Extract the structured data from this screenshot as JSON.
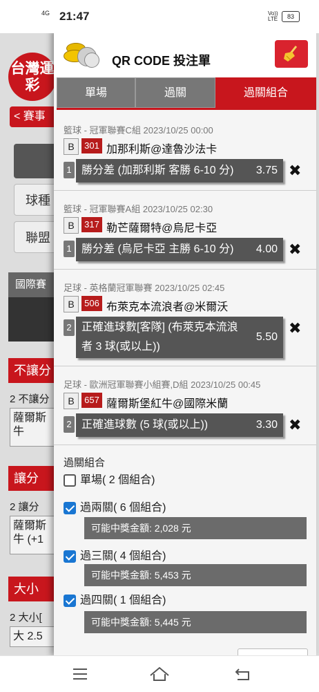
{
  "status_bar": {
    "signal": "4G",
    "time": "21:47",
    "volte": "Vo)) LTE",
    "battery": "83"
  },
  "background": {
    "logo_text": "台灣運彩",
    "tab_back": "< 賽事",
    "filter_sport": "球種",
    "filter_league": "聯盟",
    "intl_title": "國際賽",
    "section_no_handicap": "不讓分",
    "no_handicap_sub": "2 不讓分",
    "no_handicap_card": "薩爾斯 牛",
    "section_handicap": "讓分",
    "handicap_sub": "2 讓分",
    "handicap_card": "薩爾斯 牛 (+1",
    "section_total": "大小",
    "total_sub": "2 大小[",
    "total_card": "大 2.5"
  },
  "drawer": {
    "title": "QR CODE 投注單",
    "tabs": [
      "單場",
      "過關",
      "過關組合"
    ],
    "active_tab": 2,
    "colors": {
      "accent": "#c8161d",
      "check": "#1976d2"
    },
    "bets": [
      {
        "info": "籃球 - 冠軍聯賽C組 2023/10/25 00:00",
        "b": "B",
        "num": "301",
        "teams": "加那利斯@達魯沙法卡",
        "idx": "1",
        "selection": "勝分差 (加那利斯 客勝 6-10 分)",
        "odds": "3.75"
      },
      {
        "info": "籃球 - 冠軍聯賽A組 2023/10/25 02:30",
        "b": "B",
        "num": "317",
        "teams": "勒芒薩爾特@烏尼卡亞",
        "idx": "1",
        "selection": "勝分差 (烏尼卡亞 主勝 6-10 分)",
        "odds": "4.00"
      },
      {
        "info": "足球 - 英格蘭冠軍聯賽 2023/10/25 02:45",
        "b": "B",
        "num": "506",
        "teams": "布萊克本流浪者@米爾沃",
        "idx": "2",
        "selection_line1": "正確進球數[客隊] (布萊克本流浪",
        "selection_line2": "者 3 球(或以上))",
        "odds": "5.50"
      },
      {
        "info": "足球 - 歐洲冠軍聯賽小組賽,D組 2023/10/25 00:45",
        "b": "B",
        "num": "657",
        "teams": "薩爾斯堡紅牛@國際米蘭",
        "idx": "2",
        "selection": "正確進球數 (5 球(或以上))",
        "odds": "3.30"
      }
    ],
    "combo_title": "過關組合",
    "combos": [
      {
        "label": "單場( 2 個組合)",
        "checked": false
      },
      {
        "label": "過兩關( 6 個組合)",
        "checked": true,
        "prize": "可能中獎金額: 2,028 元"
      },
      {
        "label": "過三關( 4 個組合)",
        "checked": true,
        "prize": "可能中獎金額: 5,453 元"
      },
      {
        "label": "過四關( 1 個組合)",
        "checked": true,
        "prize": "可能中獎金額: 5,445 元"
      }
    ]
  }
}
